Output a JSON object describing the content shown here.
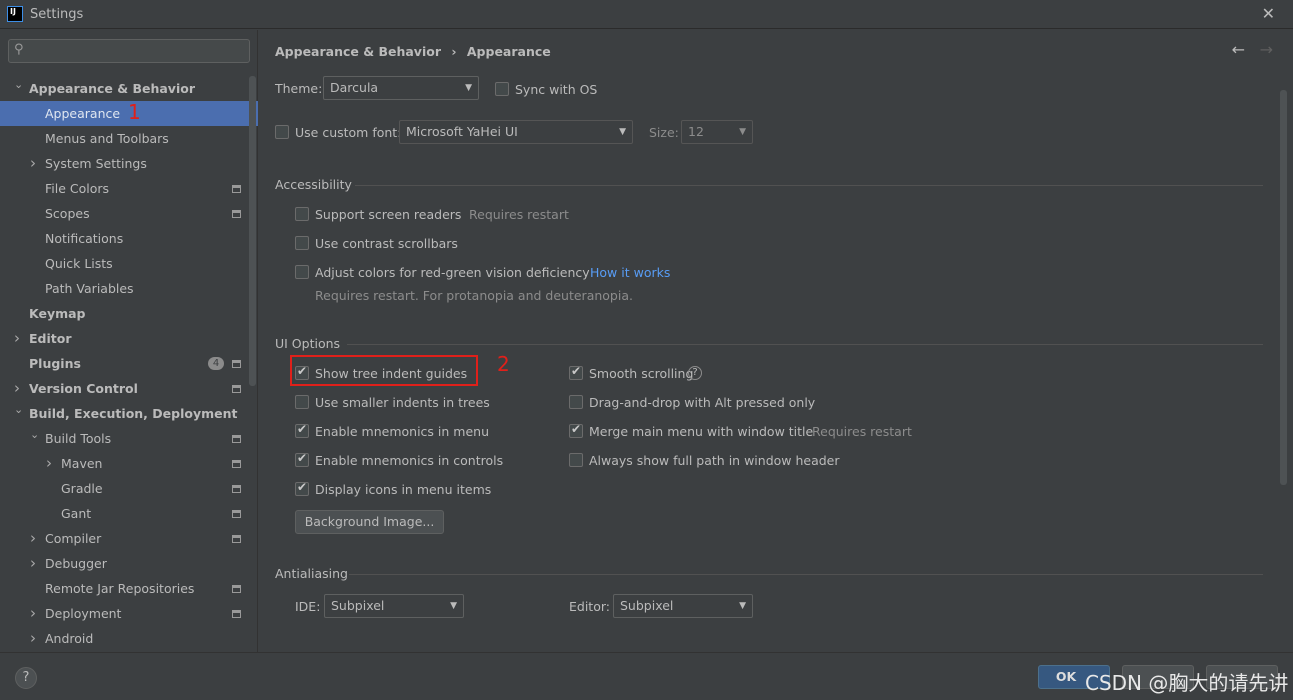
{
  "window": {
    "title": "Settings",
    "close": "✕"
  },
  "sidebar": {
    "items": [
      {
        "label": "Appearance & Behavior",
        "level": 0,
        "arrow": "⌄",
        "bold": true
      },
      {
        "label": "Appearance",
        "level": 1,
        "selected": true,
        "annotation": "1"
      },
      {
        "label": "Menus and Toolbars",
        "level": 1
      },
      {
        "label": "System Settings",
        "level": 1,
        "arrow": "›"
      },
      {
        "label": "File Colors",
        "level": 1,
        "page": true
      },
      {
        "label": "Scopes",
        "level": 1,
        "page": true
      },
      {
        "label": "Notifications",
        "level": 1
      },
      {
        "label": "Quick Lists",
        "level": 1
      },
      {
        "label": "Path Variables",
        "level": 1
      },
      {
        "label": "Keymap",
        "level": 0,
        "bold": true
      },
      {
        "label": "Editor",
        "level": 0,
        "arrow": "›",
        "bold": true
      },
      {
        "label": "Plugins",
        "level": 0,
        "bold": true,
        "badge": "4",
        "page": true
      },
      {
        "label": "Version Control",
        "level": 0,
        "arrow": "›",
        "bold": true,
        "page": true
      },
      {
        "label": "Build, Execution, Deployment",
        "level": 0,
        "arrow": "⌄",
        "bold": true
      },
      {
        "label": "Build Tools",
        "level": 1,
        "arrow": "⌄",
        "page": true
      },
      {
        "label": "Maven",
        "level": 2,
        "arrow": "›",
        "page": true
      },
      {
        "label": "Gradle",
        "level": 2,
        "page": true
      },
      {
        "label": "Gant",
        "level": 2,
        "page": true
      },
      {
        "label": "Compiler",
        "level": 1,
        "arrow": "›",
        "page": true
      },
      {
        "label": "Debugger",
        "level": 1,
        "arrow": "›"
      },
      {
        "label": "Remote Jar Repositories",
        "level": 1,
        "page": true
      },
      {
        "label": "Deployment",
        "level": 1,
        "arrow": "›",
        "page": true
      },
      {
        "label": "Android",
        "level": 1,
        "arrow": "›"
      }
    ]
  },
  "breadcrumb": {
    "parent": "Appearance & Behavior",
    "sep": "›",
    "current": "Appearance"
  },
  "theme": {
    "label": "Theme:",
    "value": "Darcula",
    "sync": "Sync with OS"
  },
  "font": {
    "label": "Use custom font:",
    "value": "Microsoft YaHei UI",
    "size_label": "Size:",
    "size": "12"
  },
  "accessibility": {
    "title": "Accessibility",
    "screen_readers": "Support screen readers",
    "requires_restart": "Requires restart",
    "contrast": "Use contrast scrollbars",
    "redgreen": "Adjust colors for red-green vision deficiency",
    "how": "How it works",
    "note": "Requires restart. For protanopia and deuteranopia."
  },
  "ui_options": {
    "title": "UI Options",
    "annotation": "2",
    "left": [
      {
        "label": "Show tree indent guides",
        "checked": true
      },
      {
        "label": "Use smaller indents in trees",
        "checked": false
      },
      {
        "label": "Enable mnemonics in menu",
        "checked": true
      },
      {
        "label": "Enable mnemonics in controls",
        "checked": true
      },
      {
        "label": "Display icons in menu items",
        "checked": true
      }
    ],
    "right": [
      {
        "label": "Smooth scrolling",
        "checked": true
      },
      {
        "label": "Drag-and-drop with Alt pressed only",
        "checked": false
      },
      {
        "label": "Merge main menu with window title",
        "checked": true
      },
      {
        "label": "Always show full path in window header",
        "checked": false
      }
    ],
    "requires_restart": "Requires restart",
    "bg_button": "Background Image..."
  },
  "antialiasing": {
    "title": "Antialiasing",
    "ide_label": "IDE:",
    "ide": "Subpixel",
    "editor_label": "Editor:",
    "editor": "Subpixel"
  },
  "footer": {
    "help": "?",
    "ok": "OK",
    "watermark": "CSDN @胸大的请先讲"
  }
}
